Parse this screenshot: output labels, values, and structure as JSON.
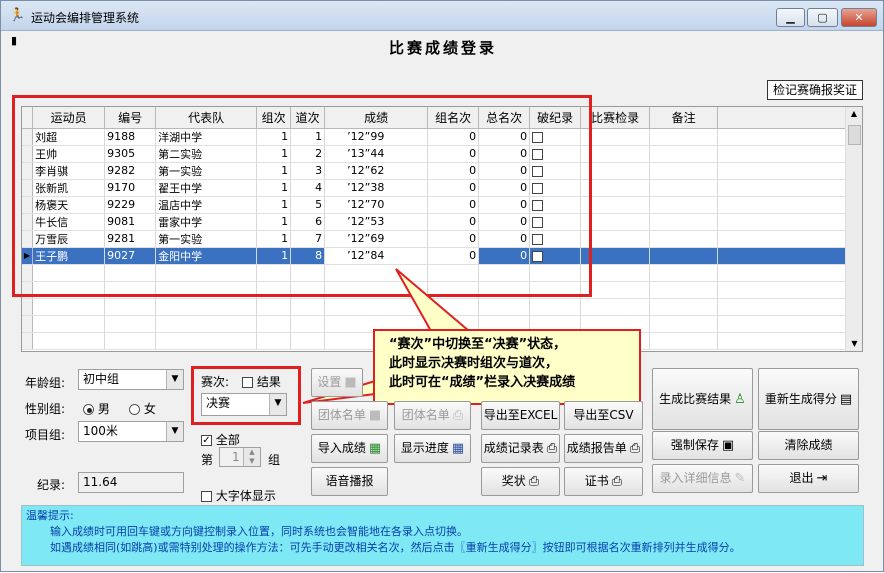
{
  "window": {
    "title": "运动会编排管理系统",
    "min": "▁",
    "max": "▢",
    "close": "✕"
  },
  "form_title": "比赛成绩登录",
  "check_record_button": "检记赛确报奖证",
  "table": {
    "headers": [
      "运动员",
      "编号",
      "代表队",
      "组次",
      "道次",
      "成绩",
      "组名次",
      "总名次",
      "破纪录",
      "比赛检录",
      "备注"
    ],
    "rows": [
      {
        "name": "刘超",
        "no": "9188",
        "team": "洋湖中学",
        "group": "1",
        "lane": "1",
        "score": "’12”99",
        "grank": "0",
        "trank": "0"
      },
      {
        "name": "王帅",
        "no": "9305",
        "team": "第二实验",
        "group": "1",
        "lane": "2",
        "score": "’13”44",
        "grank": "0",
        "trank": "0"
      },
      {
        "name": "李肖骐",
        "no": "9282",
        "team": "第一实验",
        "group": "1",
        "lane": "3",
        "score": "’12”62",
        "grank": "0",
        "trank": "0"
      },
      {
        "name": "张新凯",
        "no": "9170",
        "team": "翟王中学",
        "group": "1",
        "lane": "4",
        "score": "’12”38",
        "grank": "0",
        "trank": "0"
      },
      {
        "name": "杨褒天",
        "no": "9229",
        "team": "温店中学",
        "group": "1",
        "lane": "5",
        "score": "’12”70",
        "grank": "0",
        "trank": "0"
      },
      {
        "name": "牛长信",
        "no": "9081",
        "team": "雷家中学",
        "group": "1",
        "lane": "6",
        "score": "’12”53",
        "grank": "0",
        "trank": "0"
      },
      {
        "name": "万雪辰",
        "no": "9281",
        "team": "第一实验",
        "group": "1",
        "lane": "7",
        "score": "’12”69",
        "grank": "0",
        "trank": "0"
      },
      {
        "name": "王子鹏",
        "no": "9027",
        "team": "金阳中学",
        "group": "1",
        "lane": "8",
        "score": "’12”84",
        "grank": "0",
        "trank": "0"
      }
    ]
  },
  "callout": {
    "line1": "“赛次”中切换至“决赛”状态，",
    "line2": "此时显示决赛时组次与道次，",
    "line3": "此时可在“成绩”栏录入决赛成绩"
  },
  "left_panel": {
    "age_label": "年龄组:",
    "age_value": "初中组",
    "gender_label": "性别组:",
    "male": "男",
    "female": "女",
    "event_label": "项目组:",
    "event_value": "100米",
    "record_label": "纪录:",
    "record_value": "11.64"
  },
  "round": {
    "label": "赛次:",
    "result_check": "结果",
    "value": "决赛",
    "all_label": "全部",
    "group_pre": "第",
    "group_num": "1",
    "group_post": "组",
    "big_font": "大字体显示"
  },
  "buttons": {
    "setup": "设置",
    "team_list1": "团体名单",
    "team_list2": "团体名单",
    "import": "导入成绩",
    "progress": "显示进度",
    "voice": "语音播报",
    "export_excel": "导出至EXCEL",
    "export_csv": "导出至CSV",
    "record_table": "成绩记录表",
    "report": "成绩报告单",
    "award": "奖状",
    "cert": "证书",
    "gen_result": "生成比赛结果",
    "regen_score": "重新生成得分",
    "force_save": "强制保存",
    "clear": "清除成绩",
    "detail": "录入详细信息",
    "exit": "退出"
  },
  "tips": {
    "title": "温馨提示:",
    "line1": "输入成绩时可用回车键或方向键控制录入位置，同时系统也会智能地在各录入点切换。",
    "line2": "如遇成绩相同(如跳高)或需特别处理的操作方法：可先手动更改相关名次，然后点击〖重新生成得分〗按钮即可根据名次重新排列并生成得分。"
  },
  "colors": {
    "highlight": "#e02020",
    "selection": "#3a71c1",
    "callout_bg": "#ffffc8",
    "tip_bg": "#7ee8f4"
  }
}
